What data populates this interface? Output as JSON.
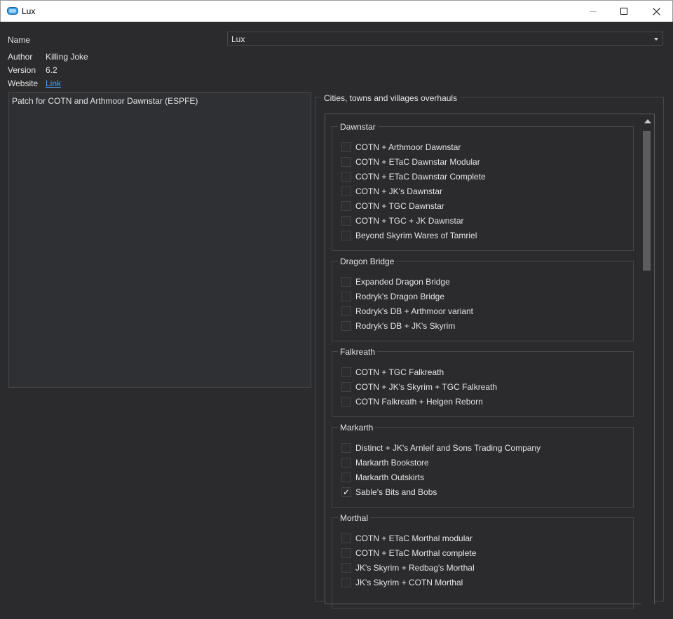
{
  "window": {
    "title": "Lux"
  },
  "info": {
    "name_label": "Name",
    "name_value": "Lux",
    "author_label": "Author",
    "author_value": "Killing Joke",
    "version_label": "Version",
    "version_value": "6.2",
    "website_label": "Website",
    "website_link": "Link",
    "description": "Patch for COTN and Arthmoor Dawnstar (ESPFE)"
  },
  "options_group": {
    "title": "Cities, towns and villages overhauls",
    "sections": [
      {
        "title": "Dawnstar",
        "options": [
          {
            "label": "COTN + Arthmoor Dawnstar",
            "checked": false
          },
          {
            "label": "COTN + ETaC Dawnstar Modular",
            "checked": false
          },
          {
            "label": "COTN + ETaC Dawnstar Complete",
            "checked": false
          },
          {
            "label": "COTN + JK's Dawnstar",
            "checked": false
          },
          {
            "label": "COTN + TGC Dawnstar",
            "checked": false
          },
          {
            "label": "COTN + TGC + JK Dawnstar",
            "checked": false
          },
          {
            "label": "Beyond Skyrim Wares of Tamriel",
            "checked": false
          }
        ]
      },
      {
        "title": "Dragon Bridge",
        "options": [
          {
            "label": "Expanded Dragon Bridge",
            "checked": false
          },
          {
            "label": "Rodryk's Dragon Bridge",
            "checked": false
          },
          {
            "label": "Rodryk's DB + Arthmoor variant",
            "checked": false
          },
          {
            "label": "Rodryk's DB + JK's Skyrim",
            "checked": false
          }
        ]
      },
      {
        "title": "Falkreath",
        "options": [
          {
            "label": "COTN + TGC Falkreath",
            "checked": false
          },
          {
            "label": "COTN + JK's Skyrim + TGC Falkreath",
            "checked": false
          },
          {
            "label": "COTN Falkreath + Helgen Reborn",
            "checked": false
          }
        ]
      },
      {
        "title": "Markarth",
        "options": [
          {
            "label": "Distinct + JK's Arnleif and Sons Trading Company",
            "checked": false
          },
          {
            "label": "Markarth Bookstore",
            "checked": false
          },
          {
            "label": "Markarth Outskirts",
            "checked": false
          },
          {
            "label": "Sable's Bits and Bobs",
            "checked": true
          }
        ]
      },
      {
        "title": "Morthal",
        "options": [
          {
            "label": "COTN + ETaC Morthal modular",
            "checked": false
          },
          {
            "label": "COTN + ETaC Morthal complete",
            "checked": false
          },
          {
            "label": "JK's Skyrim + Redbag's Morthal",
            "checked": false
          },
          {
            "label": "JK's Skyrim + COTN Morthal",
            "checked": false
          }
        ]
      }
    ]
  },
  "icons": {
    "checkmark": "✓"
  },
  "colors": {
    "background": "#2b2b2d",
    "link": "#4d9df0",
    "app_icon": "#3aa0e8"
  }
}
